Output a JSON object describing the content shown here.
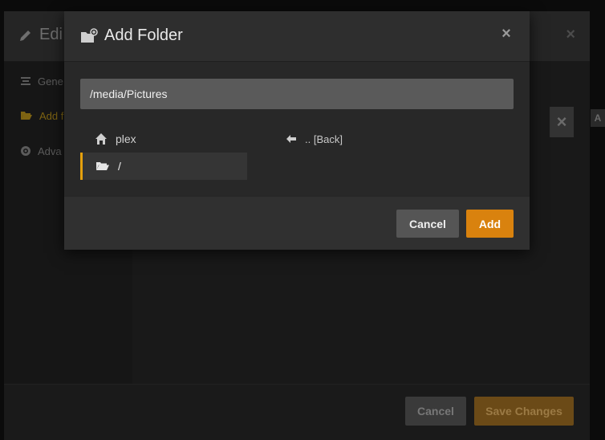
{
  "background_dialog": {
    "title": "Edi",
    "close_icon": "×",
    "sidebar": [
      {
        "label": "Gene",
        "icon": "list-icon",
        "active": false
      },
      {
        "label": "Add f",
        "icon": "folder-open-icon",
        "active": true
      },
      {
        "label": "Adva",
        "icon": "gear-icon",
        "active": false
      }
    ],
    "field_clear": "×",
    "chip": "A",
    "footer": {
      "cancel_label": "Cancel",
      "save_label": "Save Changes"
    }
  },
  "modal": {
    "title": "Add Folder",
    "close_icon": "×",
    "path_value": "/media/Pictures",
    "entries": {
      "home_label": "plex",
      "root_label": "/",
      "back_label": ".. [Back]"
    },
    "footer": {
      "cancel_label": "Cancel",
      "add_label": "Add"
    }
  },
  "colors": {
    "accent": "#e5a00d",
    "add_button": "#d9820e"
  }
}
